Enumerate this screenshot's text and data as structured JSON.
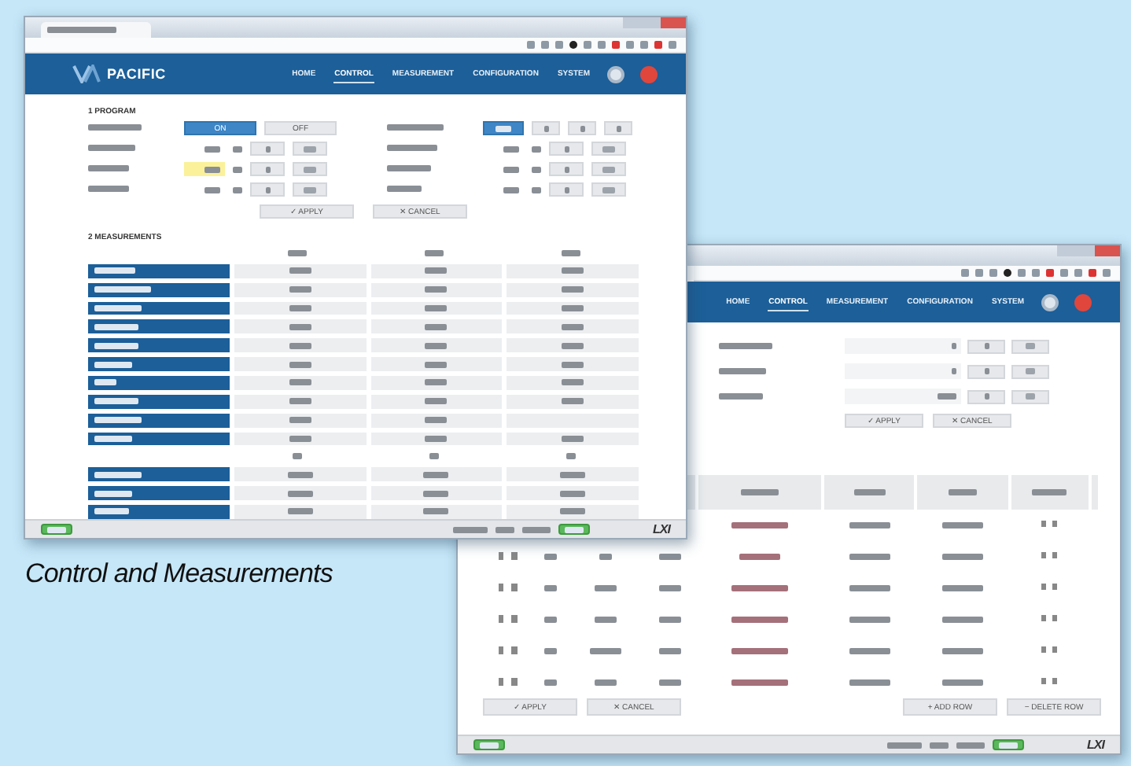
{
  "caption": "Control and Measurements",
  "front_window": {
    "logo": "PACIFIC",
    "nav": [
      {
        "label": "HOME",
        "selected": false
      },
      {
        "label": "CONTROL",
        "selected": true
      },
      {
        "label": "MEASUREMENT",
        "selected": false
      },
      {
        "label": "CONFIGURATION",
        "selected": false
      },
      {
        "label": "SYSTEM",
        "selected": false
      }
    ],
    "program_title": "1 PROGRAM",
    "output_buttons": [
      {
        "label": "ON",
        "selected": true
      },
      {
        "label": "OFF",
        "selected": false
      }
    ],
    "program_fields": [
      {
        "highlighted": false
      },
      {
        "highlighted": true
      },
      {
        "highlighted": false
      }
    ],
    "apply": "✓ APPLY",
    "cancel": "✕ CANCEL",
    "measurements_title": "2 MEASUREMENTS",
    "lxi": "LXI"
  },
  "back_window": {
    "nav": [
      {
        "label": "HOME",
        "selected": false
      },
      {
        "label": "CONTROL",
        "selected": true
      },
      {
        "label": "MEASUREMENT",
        "selected": false
      },
      {
        "label": "CONFIGURATION",
        "selected": false
      },
      {
        "label": "SYSTEM",
        "selected": false
      }
    ],
    "form_apply": "✓ APPLY",
    "form_cancel": "✕ CANCEL",
    "apply": "✓ APPLY",
    "cancel": "✕ CANCEL",
    "add_row": "+ ADD ROW",
    "delete_row": "− DELETE ROW",
    "lxi": "LXI"
  }
}
